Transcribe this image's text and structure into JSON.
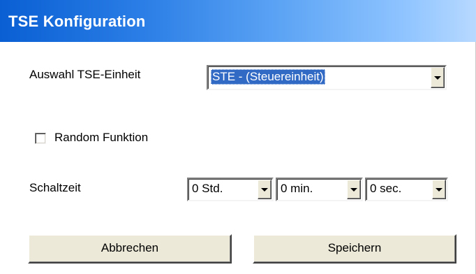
{
  "window": {
    "title": "TSE Konfiguration"
  },
  "form": {
    "unit_label": "Auswahl TSE-Einheit",
    "unit_value": "STE - (Steuereinheit)",
    "random_label": "Random Funktion",
    "random_checked": false,
    "time_label": "Schaltzeit",
    "hours_value": "0 Std.",
    "minutes_value": "0 min.",
    "seconds_value": "0 sec."
  },
  "buttons": {
    "cancel_label": "Abbrechen",
    "save_label": "Speichern"
  },
  "colors": {
    "titlebar_start": "#0a5fd3",
    "titlebar_end": "#b7d9ff",
    "selection": "#316ac5",
    "button_face": "#ece9d8"
  },
  "icons": {
    "dropdown": "chevron-down-icon"
  }
}
